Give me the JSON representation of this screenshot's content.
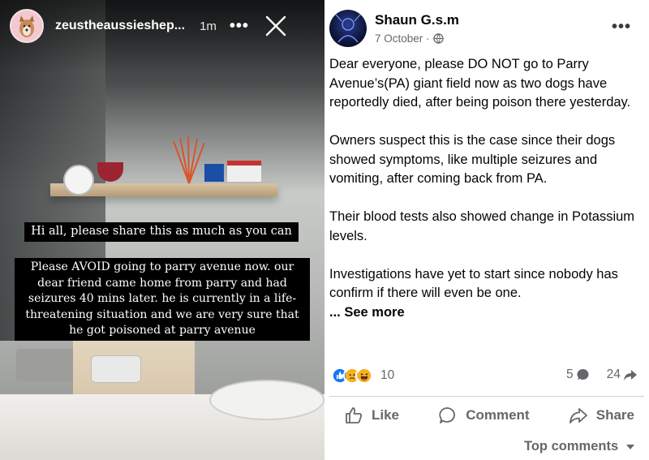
{
  "story": {
    "username": "zeustheaussieshep...",
    "time": "1m",
    "more_icon": "more-horizontal-icon",
    "close_icon": "close-icon",
    "caption_1": "Hi all, please share this as much as you can",
    "caption_2": "Please AVOID going to parry avenue now. our dear friend came home from parry and had seizures 40 mins later. he is currently in a life-threatening situation and we are very sure that he got poisoned at parry avenue"
  },
  "post": {
    "author": "Shaun G.s.m",
    "date": "7 October ·",
    "privacy_icon": "globe-icon",
    "paragraphs": [
      "Dear everyone, please DO NOT go to Parry Avenue’s(PA) giant field now as two dogs have reportedly died, after being poison there yesterday.",
      "Owners suspect this is the case since their dogs showed symptoms, like multiple seizures and vomiting, after coming back from PA.",
      "Their blood tests also showed change in Potassium levels.",
      "Investigations have yet to start since nobody has confirm if there will even be one."
    ],
    "see_more": "... See more",
    "reaction_count": "10",
    "comment_count": "5",
    "share_count": "24",
    "actions": {
      "like": "Like",
      "comment": "Comment",
      "share": "Share"
    },
    "top_comments": "Top comments",
    "colors": {
      "like_blue": "#1877f2",
      "haha_yellow": "#f7b125",
      "muted": "#65676b"
    }
  }
}
